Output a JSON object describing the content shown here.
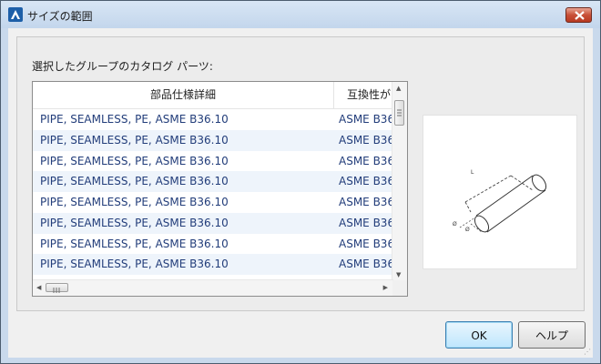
{
  "window": {
    "title": "サイズの範囲"
  },
  "caption": "選択したグループのカタログ パーツ:",
  "table": {
    "columns": [
      "部品仕様詳細",
      "互換性が"
    ],
    "rows": [
      [
        "PIPE, SEAMLESS, PE, ASME B36.10",
        "ASME B36"
      ],
      [
        "PIPE, SEAMLESS, PE, ASME B36.10",
        "ASME B36"
      ],
      [
        "PIPE, SEAMLESS, PE, ASME B36.10",
        "ASME B36"
      ],
      [
        "PIPE, SEAMLESS, PE, ASME B36.10",
        "ASME B36"
      ],
      [
        "PIPE, SEAMLESS, PE, ASME B36.10",
        "ASME B36"
      ],
      [
        "PIPE, SEAMLESS, PE, ASME B36.10",
        "ASME B36"
      ],
      [
        "PIPE, SEAMLESS, PE, ASME B36.10",
        "ASME B36"
      ],
      [
        "PIPE, SEAMLESS, PE, ASME B36.10",
        "ASME B36"
      ]
    ]
  },
  "buttons": {
    "ok": "OK",
    "help": "ヘルプ"
  },
  "icons": {
    "app": "autocad-app-icon",
    "close": "close-icon",
    "preview": "pipe-preview-image"
  },
  "colors": {
    "row_text": "#223d7a",
    "alt_row": "#eef4fb",
    "close": "#c85038"
  }
}
